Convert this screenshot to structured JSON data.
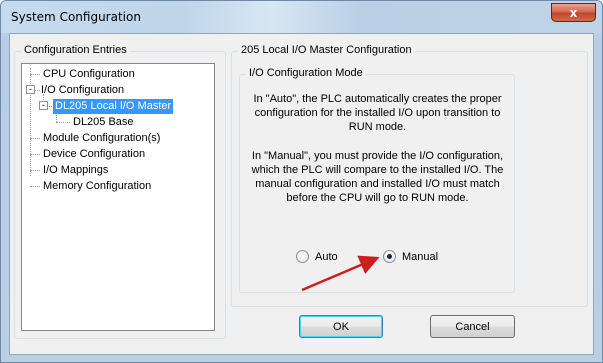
{
  "window": {
    "title": "System Configuration",
    "close_glyph": "x"
  },
  "tree": {
    "group_label": "Configuration Entries",
    "items": [
      {
        "label": "CPU Configuration"
      },
      {
        "label": "I/O Configuration",
        "expander": "-"
      },
      {
        "label": "DL205 Local I/O Master",
        "expander": "-",
        "selected": true
      },
      {
        "label": "DL205 Base"
      },
      {
        "label": "Module Configuration(s)"
      },
      {
        "label": "Device Configuration"
      },
      {
        "label": "I/O Mappings"
      },
      {
        "label": "Memory Configuration"
      }
    ]
  },
  "master": {
    "group_label": "205 Local I/O Master Configuration",
    "mode": {
      "group_label": "I/O Configuration Mode",
      "auto_text": "In \"Auto\", the PLC automatically creates the proper configuration for the installed I/O upon transition to RUN mode.",
      "manual_text": "In \"Manual\", you must provide the I/O configuration, which the PLC will compare to the installed I/O. The manual configuration and installed I/O must match before the CPU will go to RUN mode.",
      "options": [
        {
          "label": "Auto",
          "checked": false
        },
        {
          "label": "Manual",
          "checked": true
        }
      ]
    }
  },
  "buttons": {
    "ok": "OK",
    "cancel": "Cancel"
  },
  "colors": {
    "selection": "#3399ff",
    "annotation_arrow": "#cc1f1f"
  }
}
